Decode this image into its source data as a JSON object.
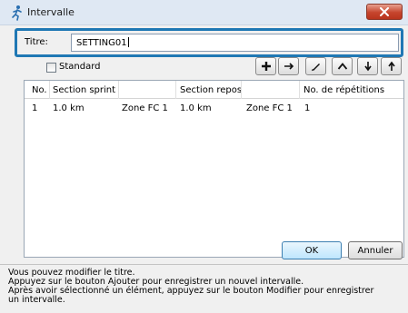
{
  "window": {
    "title": "Intervalle",
    "app_icon": "runner-icon",
    "close_icon": "close-icon"
  },
  "title_field": {
    "label": "Titre:",
    "value": "SETTING01"
  },
  "standard": {
    "label": "Standard",
    "checked": false
  },
  "toolbar": [
    {
      "name": "add-icon"
    },
    {
      "name": "insert-icon"
    },
    {
      "name": "edit-icon"
    },
    {
      "name": "up-icon"
    },
    {
      "name": "down-icon"
    },
    {
      "name": "top-icon"
    }
  ],
  "table": {
    "columns": [
      "No.",
      "Section sprint",
      "",
      "Section repos",
      "",
      "No. de répétitions"
    ],
    "rows": [
      [
        "1",
        "1.0 km",
        "Zone FC 1",
        "1.0 km",
        "Zone FC 1",
        "1"
      ]
    ]
  },
  "buttons": {
    "ok": "OK",
    "cancel": "Annuler"
  },
  "help_lines": [
    "Vous pouvez modifier le titre.",
    "Appuyez sur le bouton Ajouter pour enregistrer un nouvel intervalle.",
    "Après avoir sélectionné un élément, appuyez sur le bouton Modifier pour enregistrer",
    "un intervalle."
  ]
}
